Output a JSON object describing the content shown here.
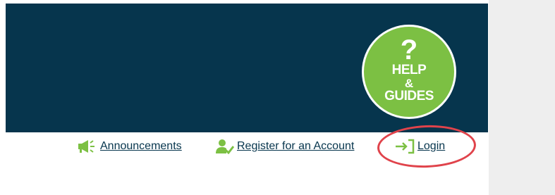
{
  "header": {
    "help_badge": {
      "question_mark": "?",
      "line1": "HELP",
      "line2": "&",
      "line3": "GUIDES"
    }
  },
  "nav": {
    "announcements_label": "Announcements",
    "register_label": "Register for an Account",
    "login_label": "Login"
  },
  "icons": {
    "announcements": "megaphone-icon",
    "register": "user-check-icon",
    "login": "sign-in-icon"
  },
  "colors": {
    "header_bg": "#06354d",
    "accent_green": "#7cc043",
    "link_color": "#06354d",
    "annotation_red": "#e0434b",
    "gutter_bg": "#eeeeee"
  }
}
